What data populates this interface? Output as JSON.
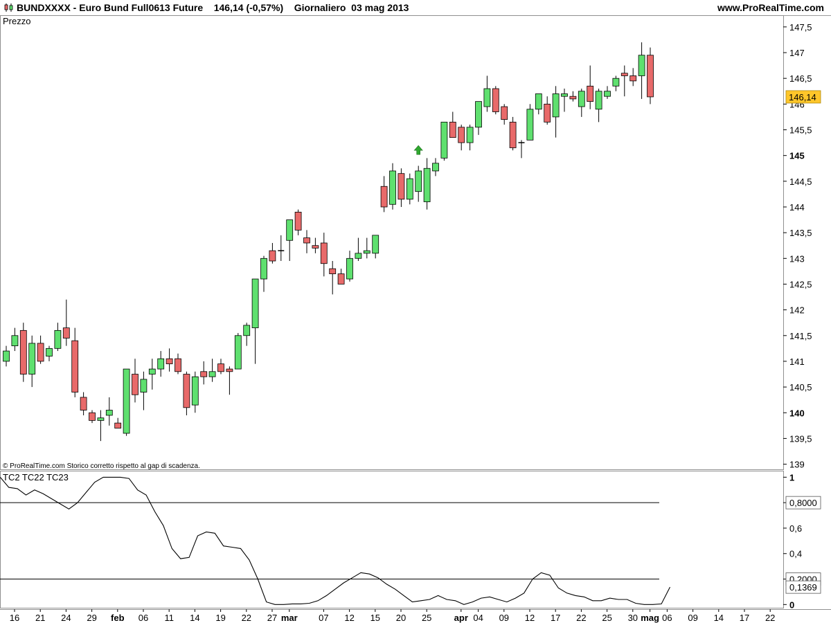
{
  "header": {
    "symbol": "BUNDXXXX",
    "instrument": "Euro Bund Full0613 Future",
    "last_price": "146,14",
    "change": "(-0,57%)",
    "period": "Giornaliero",
    "date": "03 mag 2013",
    "site": "www.ProRealTime.com"
  },
  "colors": {
    "up_candle": "#5fe06f",
    "down_candle": "#e86a6a",
    "price_tag": "#ffc62a",
    "signal_arrow": "#2fa82f"
  },
  "chart_data": [
    {
      "type": "candlestick",
      "panel_label": "Prezzo",
      "footnote": "© ProRealTime.com  Storico corretto rispetto al gap di scadenza.",
      "y_ticks": [
        "147,5",
        "147",
        "146,5",
        "146",
        "145,5",
        "145",
        "144,5",
        "144",
        "143,5",
        "143",
        "142,5",
        "142",
        "141,5",
        "141",
        "140,5",
        "140",
        "139,5",
        "139"
      ],
      "y_bold": [
        "145",
        "140"
      ],
      "ylim": [
        138.9,
        147.7
      ],
      "current_price": 146.14,
      "current_price_label": "146,14",
      "signal": {
        "type": "up-arrow",
        "bar_index": 48,
        "value": 145.1
      },
      "candles": [
        {
          "o": 141.0,
          "h": 141.3,
          "l": 140.9,
          "c": 141.2
        },
        {
          "o": 141.3,
          "h": 141.65,
          "l": 141.2,
          "c": 141.5
        },
        {
          "o": 141.6,
          "h": 141.75,
          "l": 140.6,
          "c": 140.75
        },
        {
          "o": 140.75,
          "h": 141.5,
          "l": 140.5,
          "c": 141.35
        },
        {
          "o": 141.35,
          "h": 141.5,
          "l": 140.95,
          "c": 141.0
        },
        {
          "o": 141.1,
          "h": 141.3,
          "l": 141.0,
          "c": 141.25
        },
        {
          "o": 141.25,
          "h": 141.75,
          "l": 141.2,
          "c": 141.6
        },
        {
          "o": 141.65,
          "h": 142.2,
          "l": 141.3,
          "c": 141.45
        },
        {
          "o": 141.4,
          "h": 141.65,
          "l": 140.3,
          "c": 140.4
        },
        {
          "o": 140.3,
          "h": 140.4,
          "l": 139.95,
          "c": 140.05
        },
        {
          "o": 140.0,
          "h": 140.05,
          "l": 139.8,
          "c": 139.85
        },
        {
          "o": 139.85,
          "h": 140.05,
          "l": 139.45,
          "c": 139.9
        },
        {
          "o": 139.95,
          "h": 140.3,
          "l": 139.75,
          "c": 140.05
        },
        {
          "o": 139.8,
          "h": 139.9,
          "l": 139.7,
          "c": 139.7
        },
        {
          "o": 139.6,
          "h": 140.85,
          "l": 139.55,
          "c": 140.85
        },
        {
          "o": 140.75,
          "h": 141.05,
          "l": 140.2,
          "c": 140.35
        },
        {
          "o": 140.4,
          "h": 140.8,
          "l": 140.05,
          "c": 140.65
        },
        {
          "o": 140.75,
          "h": 141.05,
          "l": 140.45,
          "c": 140.85
        },
        {
          "o": 140.85,
          "h": 141.2,
          "l": 140.7,
          "c": 141.05
        },
        {
          "o": 141.05,
          "h": 141.25,
          "l": 140.8,
          "c": 140.95
        },
        {
          "o": 141.05,
          "h": 141.15,
          "l": 140.75,
          "c": 140.8
        },
        {
          "o": 140.75,
          "h": 140.8,
          "l": 139.95,
          "c": 140.1
        },
        {
          "o": 140.15,
          "h": 140.8,
          "l": 140.0,
          "c": 140.7
        },
        {
          "o": 140.8,
          "h": 141.0,
          "l": 140.55,
          "c": 140.7
        },
        {
          "o": 140.7,
          "h": 141.05,
          "l": 140.6,
          "c": 140.8
        },
        {
          "o": 140.95,
          "h": 141.05,
          "l": 140.75,
          "c": 140.8
        },
        {
          "o": 140.85,
          "h": 140.9,
          "l": 140.35,
          "c": 140.8
        },
        {
          "o": 140.85,
          "h": 141.55,
          "l": 140.85,
          "c": 141.5
        },
        {
          "o": 141.5,
          "h": 141.75,
          "l": 141.3,
          "c": 141.7
        },
        {
          "o": 141.65,
          "h": 142.6,
          "l": 140.95,
          "c": 142.6
        },
        {
          "o": 142.6,
          "h": 143.05,
          "l": 142.35,
          "c": 143.0
        },
        {
          "o": 143.15,
          "h": 143.3,
          "l": 142.9,
          "c": 142.95
        },
        {
          "o": 143.15,
          "h": 143.45,
          "l": 142.95,
          "c": 143.15
        },
        {
          "o": 143.35,
          "h": 143.75,
          "l": 142.95,
          "c": 143.75
        },
        {
          "o": 143.9,
          "h": 143.95,
          "l": 143.45,
          "c": 143.55
        },
        {
          "o": 143.4,
          "h": 143.55,
          "l": 143.1,
          "c": 143.3
        },
        {
          "o": 143.25,
          "h": 143.4,
          "l": 143.1,
          "c": 143.2
        },
        {
          "o": 143.3,
          "h": 143.5,
          "l": 142.65,
          "c": 142.9
        },
        {
          "o": 142.8,
          "h": 142.95,
          "l": 142.3,
          "c": 142.7
        },
        {
          "o": 142.7,
          "h": 142.8,
          "l": 142.5,
          "c": 142.5
        },
        {
          "o": 142.6,
          "h": 143.15,
          "l": 142.55,
          "c": 143.0
        },
        {
          "o": 143.0,
          "h": 143.4,
          "l": 142.95,
          "c": 143.1
        },
        {
          "o": 143.1,
          "h": 143.4,
          "l": 143.0,
          "c": 143.15
        },
        {
          "o": 143.1,
          "h": 143.45,
          "l": 143.0,
          "c": 143.45
        },
        {
          "o": 144.4,
          "h": 144.6,
          "l": 143.9,
          "c": 144.0
        },
        {
          "o": 144.05,
          "h": 144.85,
          "l": 143.95,
          "c": 144.7
        },
        {
          "o": 144.65,
          "h": 144.75,
          "l": 144.0,
          "c": 144.15
        },
        {
          "o": 144.15,
          "h": 144.65,
          "l": 144.05,
          "c": 144.55
        },
        {
          "o": 144.3,
          "h": 144.8,
          "l": 144.1,
          "c": 144.7
        },
        {
          "o": 144.1,
          "h": 144.95,
          "l": 143.95,
          "c": 144.75
        },
        {
          "o": 144.7,
          "h": 144.95,
          "l": 144.6,
          "c": 144.85
        },
        {
          "o": 144.95,
          "h": 145.65,
          "l": 144.9,
          "c": 145.65
        },
        {
          "o": 145.65,
          "h": 145.85,
          "l": 145.35,
          "c": 145.35
        },
        {
          "o": 145.55,
          "h": 145.6,
          "l": 145.1,
          "c": 145.25
        },
        {
          "o": 145.25,
          "h": 145.6,
          "l": 145.1,
          "c": 145.55
        },
        {
          "o": 145.55,
          "h": 146.05,
          "l": 145.4,
          "c": 146.05
        },
        {
          "o": 145.95,
          "h": 146.55,
          "l": 145.85,
          "c": 146.3
        },
        {
          "o": 146.3,
          "h": 146.35,
          "l": 145.8,
          "c": 145.85
        },
        {
          "o": 145.95,
          "h": 146.0,
          "l": 145.6,
          "c": 145.7
        },
        {
          "o": 145.65,
          "h": 145.75,
          "l": 145.1,
          "c": 145.15
        },
        {
          "o": 145.25,
          "h": 145.3,
          "l": 144.95,
          "c": 145.25
        },
        {
          "o": 145.3,
          "h": 146.0,
          "l": 145.3,
          "c": 145.9
        },
        {
          "o": 145.9,
          "h": 146.2,
          "l": 145.8,
          "c": 146.2
        },
        {
          "o": 146.0,
          "h": 146.15,
          "l": 145.6,
          "c": 145.65
        },
        {
          "o": 145.75,
          "h": 146.35,
          "l": 145.35,
          "c": 146.2
        },
        {
          "o": 146.15,
          "h": 146.3,
          "l": 145.85,
          "c": 146.2
        },
        {
          "o": 146.15,
          "h": 146.25,
          "l": 146.05,
          "c": 146.1
        },
        {
          "o": 145.95,
          "h": 146.3,
          "l": 145.75,
          "c": 146.25
        },
        {
          "o": 146.35,
          "h": 146.75,
          "l": 145.9,
          "c": 146.05
        },
        {
          "o": 145.9,
          "h": 146.3,
          "l": 145.65,
          "c": 146.25
        },
        {
          "o": 146.15,
          "h": 146.35,
          "l": 146.1,
          "c": 146.25
        },
        {
          "o": 146.35,
          "h": 146.55,
          "l": 146.25,
          "c": 146.5
        },
        {
          "o": 146.6,
          "h": 146.75,
          "l": 146.15,
          "c": 146.55
        },
        {
          "o": 146.55,
          "h": 146.7,
          "l": 146.35,
          "c": 146.45
        },
        {
          "o": 146.55,
          "h": 147.2,
          "l": 146.1,
          "c": 146.95
        },
        {
          "o": 146.95,
          "h": 147.1,
          "l": 146.0,
          "c": 146.14
        }
      ]
    },
    {
      "type": "line",
      "panel_label": "TC2 TC22 TC23",
      "y_ticks": [
        "1",
        "0,8000",
        "0,6",
        "0,4",
        "0,2000",
        "0"
      ],
      "y_bold": [
        "1",
        "0"
      ],
      "ylim": [
        -0.02,
        1.04
      ],
      "reference_lines": [
        0.8,
        0.2
      ],
      "current_value": 0.1369,
      "current_value_label": "0,1369",
      "series": [
        {
          "values": [
            1.0,
            0.92,
            0.91,
            0.86,
            0.9,
            0.87,
            0.83,
            0.79,
            0.75,
            0.8,
            0.88,
            0.96,
            1.0,
            1.0,
            1.0,
            0.99,
            0.9,
            0.86,
            0.73,
            0.62,
            0.44,
            0.36,
            0.37,
            0.54,
            0.57,
            0.56,
            0.46,
            0.45,
            0.44,
            0.35,
            0.2,
            0.02,
            0.0,
            0.0,
            0.005,
            0.005,
            0.01,
            0.03,
            0.07,
            0.12,
            0.17,
            0.21,
            0.25,
            0.24,
            0.21,
            0.16,
            0.12,
            0.07,
            0.02,
            0.03,
            0.04,
            0.07,
            0.04,
            0.03,
            0.0,
            0.02,
            0.05,
            0.06,
            0.04,
            0.02,
            0.05,
            0.09,
            0.2,
            0.25,
            0.23,
            0.13,
            0.09,
            0.07,
            0.06,
            0.03,
            0.03,
            0.05,
            0.04,
            0.04,
            0.01,
            0.0,
            0.0,
            0.005,
            0.1369
          ]
        }
      ]
    }
  ],
  "x_axis": {
    "ticks": [
      {
        "label": "16",
        "bold": false,
        "pos": 0
      },
      {
        "label": "21",
        "bold": false,
        "pos": 3
      },
      {
        "label": "24",
        "bold": false,
        "pos": 6
      },
      {
        "label": "29",
        "bold": false,
        "pos": 9
      },
      {
        "label": "feb",
        "bold": true,
        "pos": 12
      },
      {
        "label": "06",
        "bold": false,
        "pos": 15
      },
      {
        "label": "11",
        "bold": false,
        "pos": 18
      },
      {
        "label": "14",
        "bold": false,
        "pos": 21
      },
      {
        "label": "19",
        "bold": false,
        "pos": 24
      },
      {
        "label": "22",
        "bold": false,
        "pos": 27
      },
      {
        "label": "27",
        "bold": false,
        "pos": 30
      },
      {
        "label": "mar",
        "bold": true,
        "pos": 32
      },
      {
        "label": "07",
        "bold": false,
        "pos": 36
      },
      {
        "label": "12",
        "bold": false,
        "pos": 39
      },
      {
        "label": "15",
        "bold": false,
        "pos": 42
      },
      {
        "label": "20",
        "bold": false,
        "pos": 45
      },
      {
        "label": "25",
        "bold": false,
        "pos": 48
      },
      {
        "label": "apr",
        "bold": true,
        "pos": 52
      },
      {
        "label": "04",
        "bold": false,
        "pos": 54
      },
      {
        "label": "09",
        "bold": false,
        "pos": 57
      },
      {
        "label": "12",
        "bold": false,
        "pos": 60
      },
      {
        "label": "17",
        "bold": false,
        "pos": 63
      },
      {
        "label": "22",
        "bold": false,
        "pos": 66
      },
      {
        "label": "25",
        "bold": false,
        "pos": 69
      },
      {
        "label": "30",
        "bold": false,
        "pos": 72
      },
      {
        "label": "mag",
        "bold": true,
        "pos": 74
      },
      {
        "label": "06",
        "bold": false,
        "pos": 76
      },
      {
        "label": "09",
        "bold": false,
        "pos": 79
      },
      {
        "label": "14",
        "bold": false,
        "pos": 82
      },
      {
        "label": "17",
        "bold": false,
        "pos": 85
      },
      {
        "label": "22",
        "bold": false,
        "pos": 88
      }
    ]
  }
}
